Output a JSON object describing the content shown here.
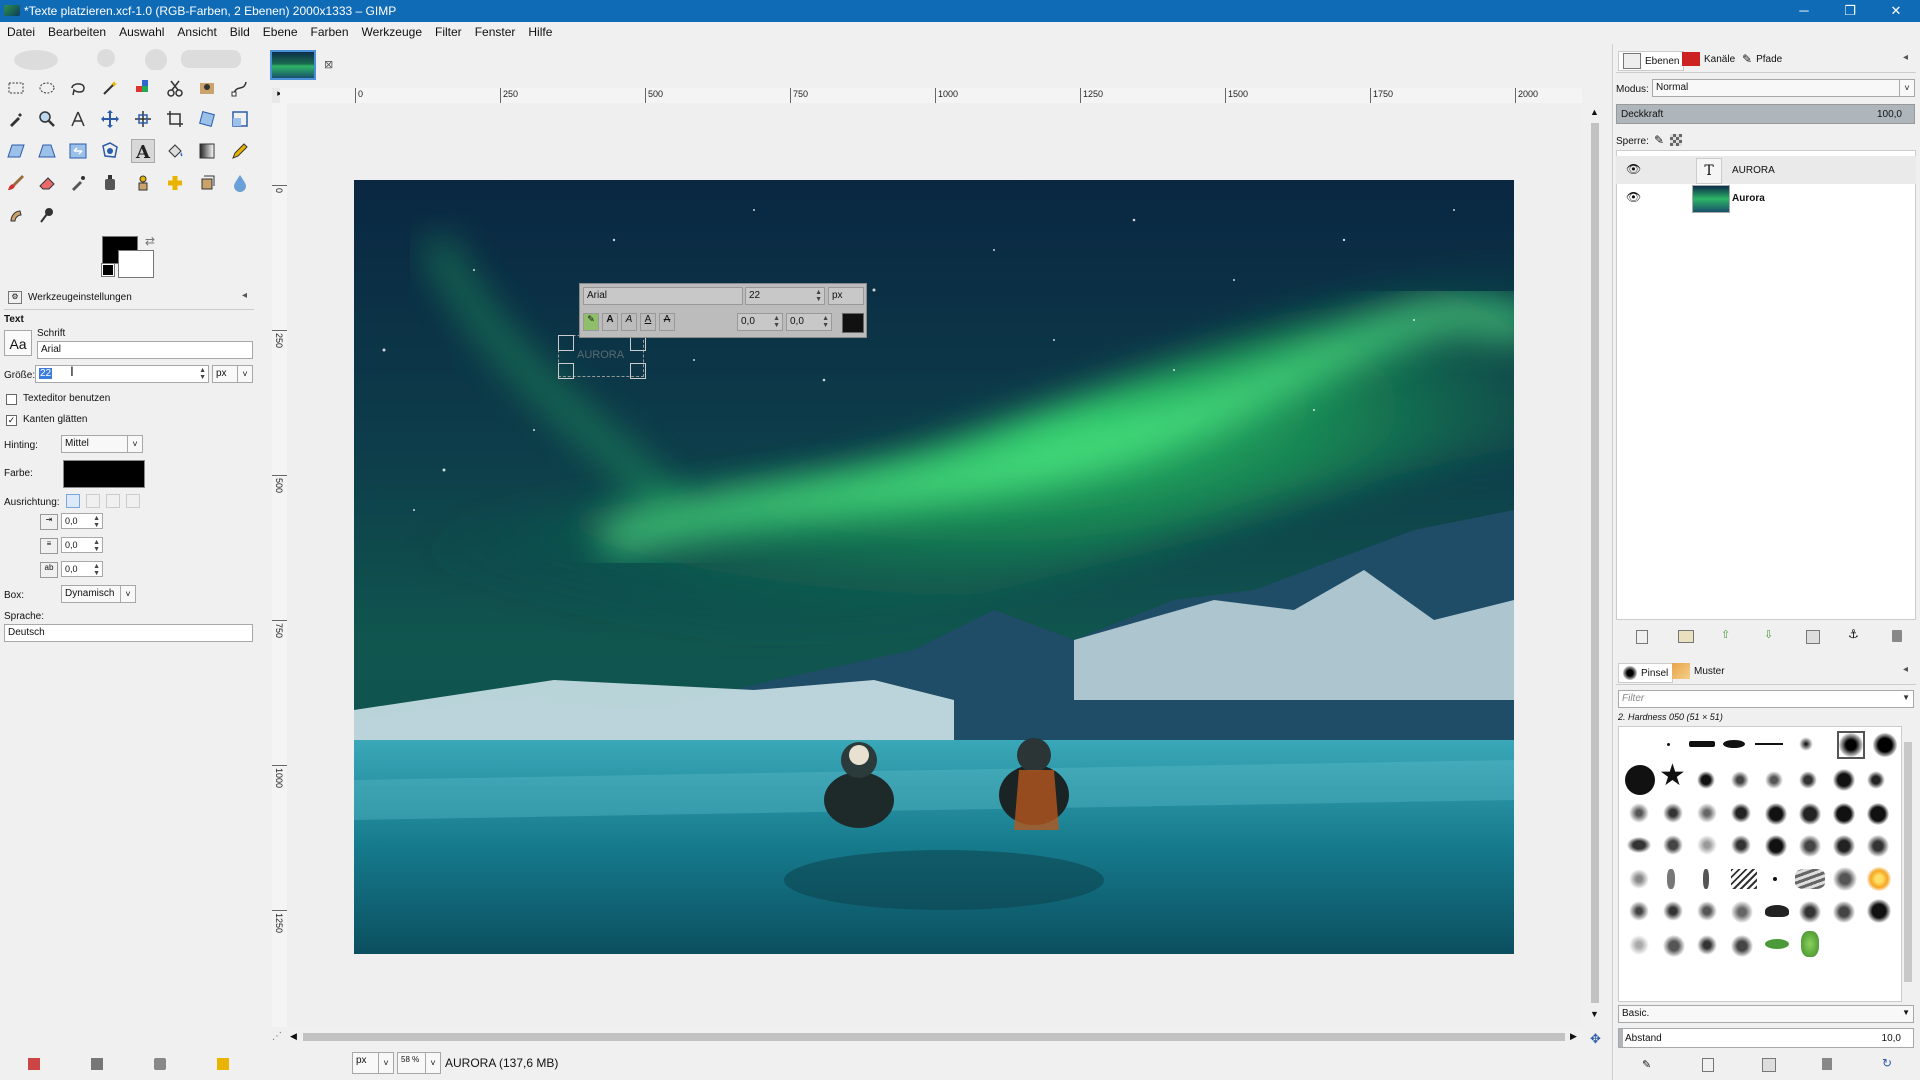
{
  "window": {
    "title": "*Texte platzieren.xcf-1.0 (RGB-Farben, 2 Ebenen) 2000x1333 – GIMP",
    "minimize": "─",
    "restore": "❐",
    "close": "✕"
  },
  "menu": [
    "Datei",
    "Bearbeiten",
    "Auswahl",
    "Ansicht",
    "Bild",
    "Ebene",
    "Farben",
    "Werkzeuge",
    "Filter",
    "Fenster",
    "Hilfe"
  ],
  "tool_options": {
    "tab_label": "Werkzeugeinstellungen",
    "section": "Text",
    "font_label": "Schrift",
    "font_preview": "Aa",
    "font_value": "Arial",
    "size_label": "Größe:",
    "size_value": "22",
    "size_unit": "px",
    "use_editor": "Texteditor benutzen",
    "antialias": "Kanten glätten",
    "hinting_label": "Hinting:",
    "hinting_value": "Mittel",
    "color_label": "Farbe:",
    "justify_label": "Ausrichtung:",
    "indent_value": "0,0",
    "line_spacing_value": "0,0",
    "letter_spacing_value": "0,0",
    "box_label": "Box:",
    "box_value": "Dynamisch",
    "language_label": "Sprache:",
    "language_value": "Deutsch"
  },
  "text_overlay": {
    "font": "Arial",
    "size": "22",
    "unit": "px",
    "baseline": "0,0",
    "kerning": "0,0",
    "typed_text": "AURORA"
  },
  "rulers": {
    "h_labels": [
      "0",
      "250",
      "500",
      "750",
      "1000",
      "1250",
      "1500",
      "1750",
      "2000"
    ],
    "v_labels": [
      "0",
      "250",
      "500",
      "750",
      "1000",
      "1250"
    ]
  },
  "status": {
    "unit": "px",
    "zoom": "58 %",
    "message": "AURORA (137,6 MB)"
  },
  "layers_dock": {
    "tabs": [
      "Ebenen",
      "Kanäle",
      "Pfade"
    ],
    "mode_label": "Modus:",
    "mode_value": "Normal",
    "opacity_label": "Deckkraft",
    "opacity_value": "100,0",
    "lock_label": "Sperre:",
    "layers": [
      {
        "name": "AURORA",
        "bold": false
      },
      {
        "name": "Aurora",
        "bold": true
      }
    ]
  },
  "brushes_dock": {
    "tabs": [
      "Pinsel",
      "Muster"
    ],
    "filter_placeholder": "Filter",
    "brush_name": "2. Hardness 050 (51 × 51)",
    "preset": "Basic.",
    "spacing_label": "Abstand",
    "spacing_value": "10,0"
  },
  "colors": {
    "titlebar": "#0f6bb5",
    "foreground": "#000000",
    "background": "#ffffff"
  }
}
